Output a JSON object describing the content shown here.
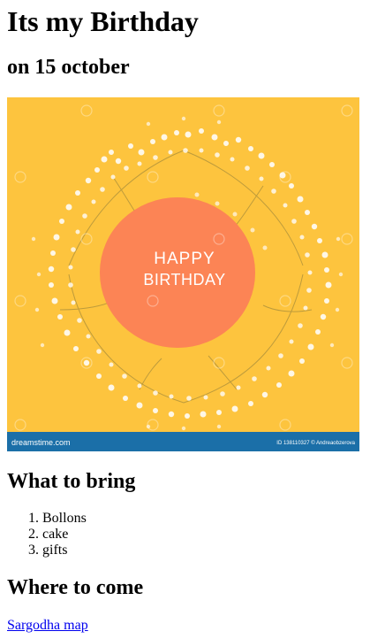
{
  "heading": {
    "title": "Its my Birthday",
    "subtitle": "on 15 october"
  },
  "photo": {
    "card_line1": "HAPPY",
    "card_line2": "BIRTHDAY",
    "footer_brand": "dreamstime.com",
    "footer_id": "ID 138110327 © Andreaobzerova",
    "colors": {
      "background": "#fcbf34",
      "card": "#fb7f4f",
      "footer": "#1b6fa8"
    }
  },
  "bring": {
    "heading": "What to bring",
    "items": [
      "Bollons",
      "cake",
      "gifts"
    ]
  },
  "location": {
    "heading": "Where to come",
    "link_text": "Sargodha map"
  }
}
